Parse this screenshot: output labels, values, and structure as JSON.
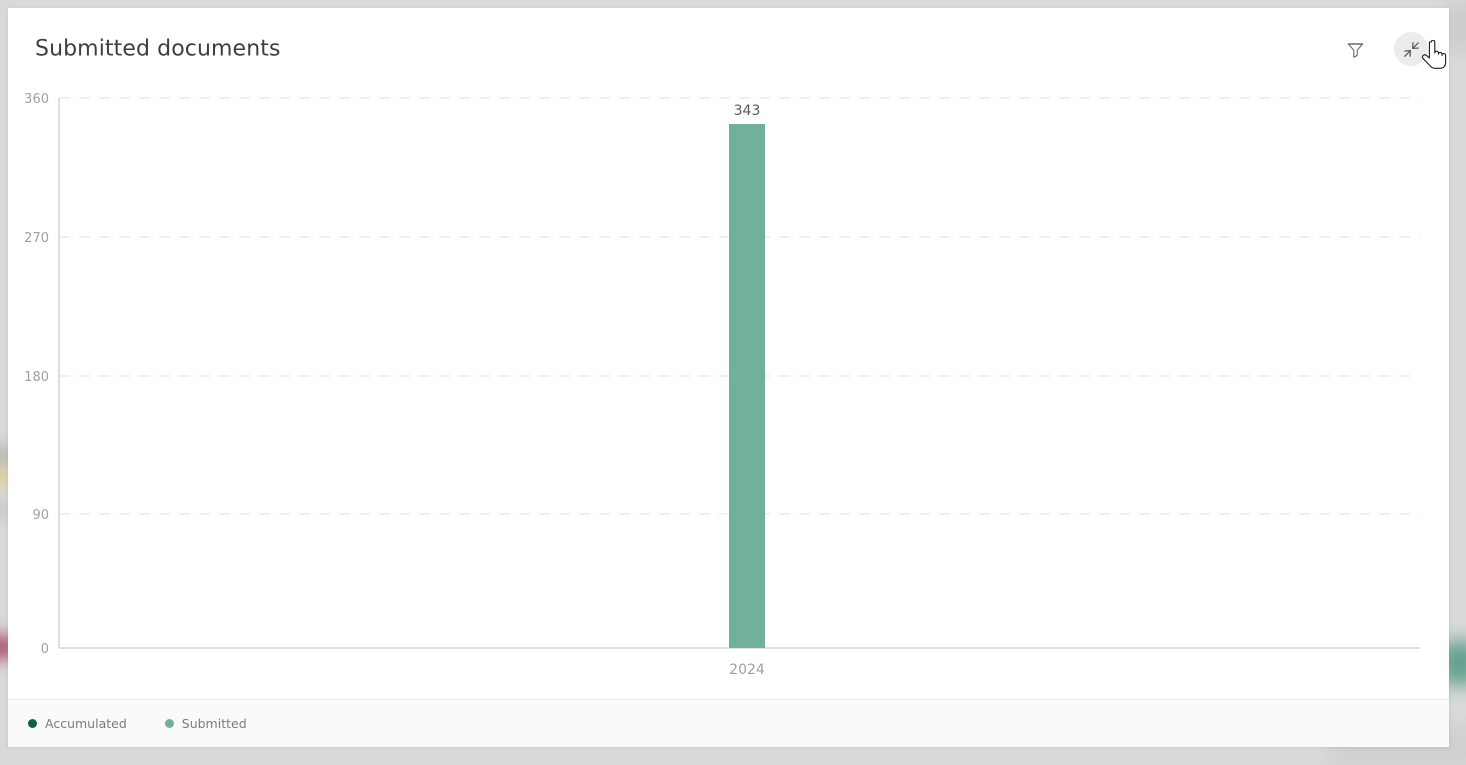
{
  "card": {
    "title": "Submitted documents",
    "actions": [
      {
        "name": "filter-icon",
        "label": "Filter",
        "hovered": false
      },
      {
        "name": "collapse-icon",
        "label": "Collapse",
        "hovered": true
      }
    ]
  },
  "colors": {
    "bar_submitted": "#71b09b",
    "legend_accumulated": "#0f5d49",
    "legend_submitted": "#71b09b",
    "grid": "#ebebeb",
    "axis": "#d6d6d6",
    "tick_text": "#a0a0a0",
    "title_text": "#3f3f3f",
    "value_label": "#5b5b5b",
    "card_bg": "#ffffff",
    "legend_bg": "#fafafa",
    "page_bg": "#d8d8d8"
  },
  "chart_data": {
    "type": "bar",
    "title": "Submitted documents",
    "xlabel": "",
    "ylabel": "",
    "categories": [
      "2024"
    ],
    "series": [
      {
        "name": "Accumulated",
        "color": "#0f5d49",
        "values": []
      },
      {
        "name": "Submitted",
        "color": "#71b09b",
        "values": [
          343
        ]
      }
    ],
    "values": [
      343
    ],
    "data_labels": [
      "343"
    ],
    "ylim": [
      0,
      360
    ],
    "yticks": [
      0,
      90,
      180,
      270,
      360
    ],
    "ytick_labels": [
      "0",
      "90",
      "180",
      "270",
      "360"
    ],
    "xtick_labels": [
      "2024"
    ],
    "grid": true,
    "grid_style": "dashed-horizontal",
    "legend_position": "bottom-left"
  }
}
